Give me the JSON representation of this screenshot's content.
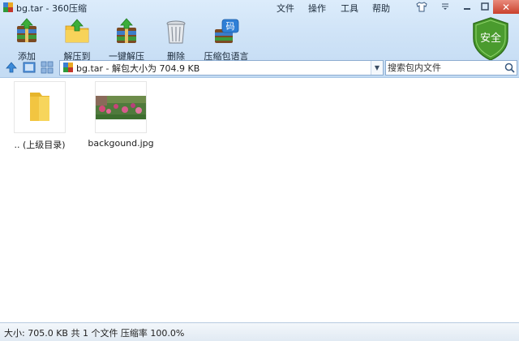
{
  "window": {
    "title": "bg.tar - 360压缩"
  },
  "menu": [
    "文件",
    "操作",
    "工具",
    "帮助"
  ],
  "toolbar": [
    {
      "label": "添加",
      "icon": "add-archive-icon"
    },
    {
      "label": "解压到",
      "icon": "extract-to-icon"
    },
    {
      "label": "一键解压",
      "icon": "one-click-extract-icon"
    },
    {
      "label": "删除",
      "icon": "delete-trash-icon"
    },
    {
      "label": "压缩包语言",
      "icon": "archive-language-icon"
    }
  ],
  "shield": {
    "label": "安全",
    "color": "#4a9b2e"
  },
  "address": {
    "text": "bg.tar - 解包大小为 704.9 KB"
  },
  "search": {
    "placeholder": "搜索包内文件"
  },
  "files": [
    {
      "name": ".. (上级目录)",
      "type": "folder-up"
    },
    {
      "name": "backgound.jpg",
      "type": "image"
    }
  ],
  "status": {
    "text": "大小: 705.0 KB 共 1 个文件 压缩率 100.0%"
  }
}
